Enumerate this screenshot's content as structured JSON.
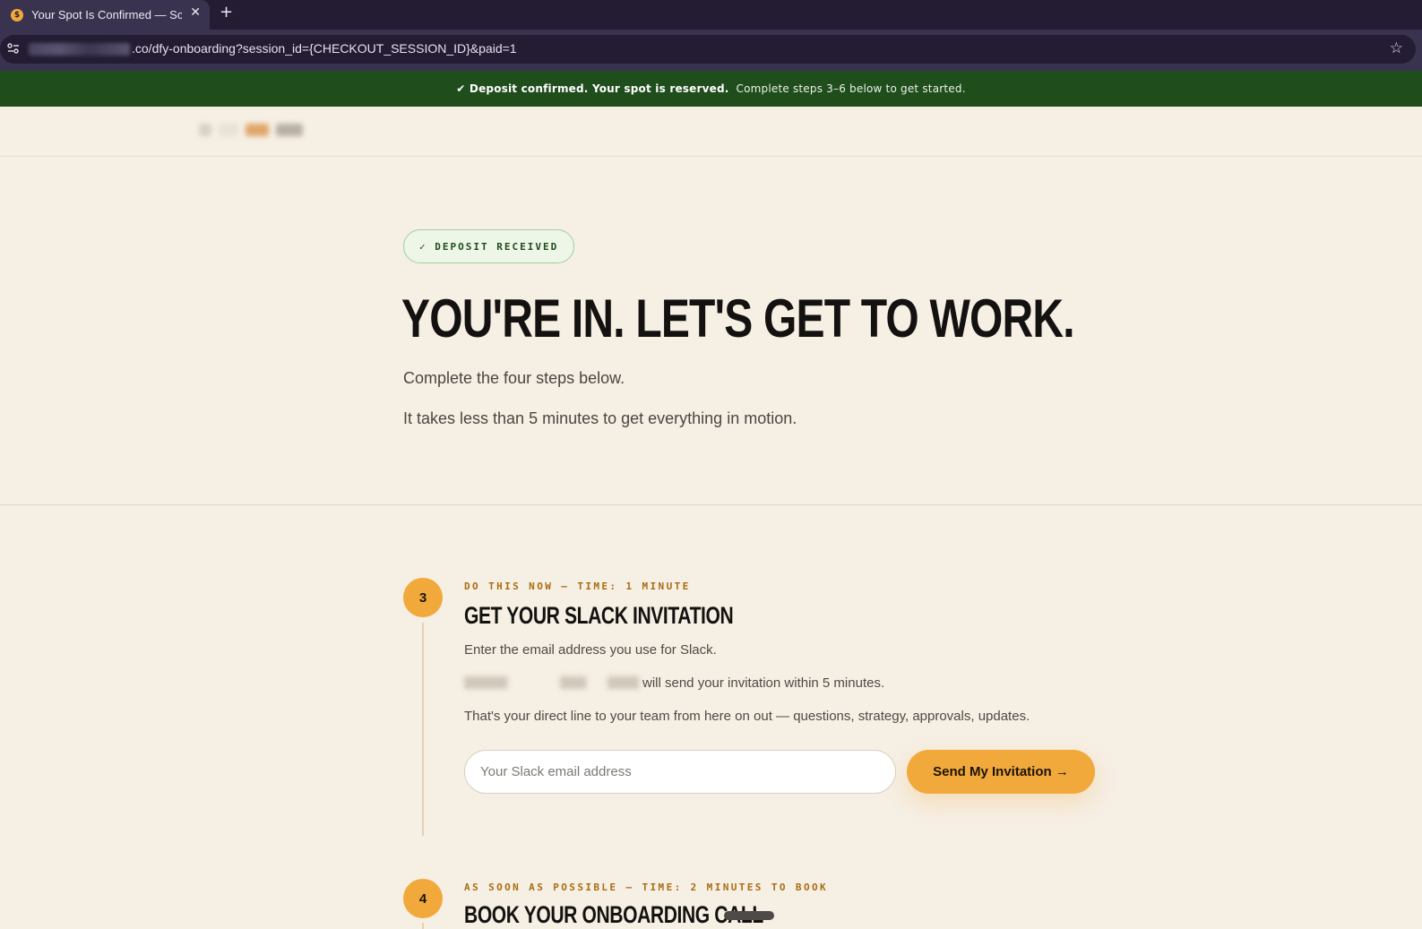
{
  "browser": {
    "tab_title": "Your Spot Is Confirmed — Sch",
    "tab_favicon": "$",
    "tab_close": "✕",
    "new_tab": "+",
    "url_visible": ".co/dfy-onboarding?session_id={CHECKOUT_SESSION_ID}&paid=1",
    "star": "☆"
  },
  "banner": {
    "strong": "✔ Deposit confirmed. Your spot is reserved.",
    "text": "Complete steps 3–6 below to get started.",
    "color": "#1f4d1c"
  },
  "hero": {
    "badge": "✓ DEPOSIT RECEIVED",
    "title": "YOU'RE IN. LET'S GET TO WORK.",
    "subtitle_1": "Complete the four steps below.",
    "subtitle_2": "It takes less than 5 minutes to get everything in motion."
  },
  "steps": [
    {
      "number": "3",
      "eyebrow": "DO THIS NOW — TIME: 1 MINUTE",
      "title": "GET YOUR SLACK INVITATION",
      "line_1": "Enter the email address you use for Slack.",
      "line_2": "will send your invitation within 5 minutes.",
      "line_3": "That's your direct line to your team from here on out — questions, strategy, approvals, updates.",
      "input_placeholder": "Your Slack email address",
      "button_label": "Send My Invitation →"
    },
    {
      "number": "4",
      "eyebrow": "AS SOON AS POSSIBLE — TIME: 2 MINUTES TO BOOK",
      "title": "BOOK YOUR ONBOARDING CALL"
    }
  ],
  "colors": {
    "accent": "#f2a93b",
    "background": "#f6efe4",
    "eyebrow": "#a96d12"
  }
}
